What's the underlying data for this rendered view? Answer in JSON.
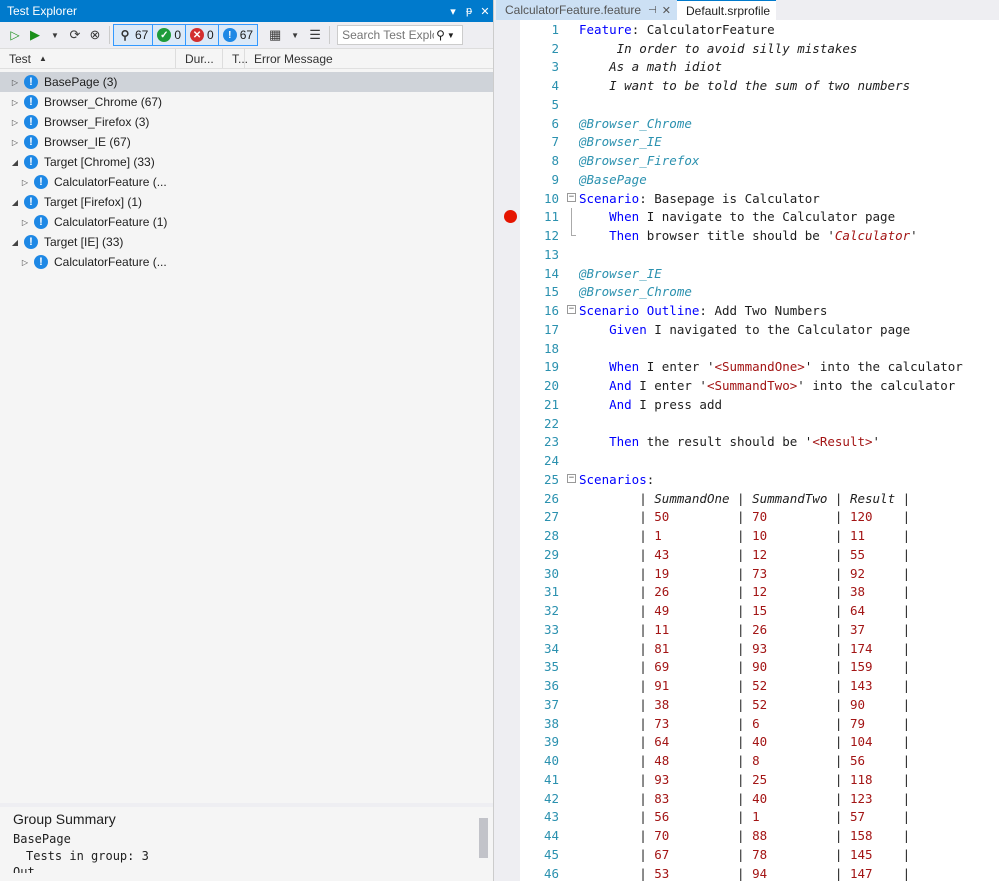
{
  "test_explorer": {
    "title": "Test Explorer",
    "title_controls": [
      "▾",
      "ᵽ",
      "✕"
    ],
    "toolbar": {
      "counts": [
        {
          "icon": "flask-icon",
          "value": "67"
        },
        {
          "icon": "passed-icon",
          "value": "0"
        },
        {
          "icon": "failed-icon",
          "value": "0"
        },
        {
          "icon": "not-run-icon",
          "value": "67"
        }
      ],
      "search_placeholder": "Search Test Explorer"
    },
    "columns": [
      "Test",
      "Dur...",
      "T...",
      "Error Message"
    ],
    "tree": [
      {
        "label": "BasePage  (3)",
        "expanded": false,
        "level": 0,
        "selected": true
      },
      {
        "label": "Browser_Chrome  (67)",
        "expanded": false,
        "level": 0
      },
      {
        "label": "Browser_Firefox  (3)",
        "expanded": false,
        "level": 0
      },
      {
        "label": "Browser_IE  (67)",
        "expanded": false,
        "level": 0
      },
      {
        "label": "Target [Chrome]  (33)",
        "expanded": true,
        "level": 0
      },
      {
        "label": "CalculatorFeature  (...",
        "expanded": false,
        "level": 1
      },
      {
        "label": "Target [Firefox]  (1)",
        "expanded": true,
        "level": 0
      },
      {
        "label": "CalculatorFeature  (1)",
        "expanded": false,
        "level": 1
      },
      {
        "label": "Target [IE]  (33)",
        "expanded": true,
        "level": 0
      },
      {
        "label": "CalculatorFeature  (...",
        "expanded": false,
        "level": 1
      }
    ],
    "summary": {
      "title": "Group Summary",
      "group_name": "BasePage",
      "tests_in_group": "Tests in group: 3",
      "next_line": "Out..."
    }
  },
  "editor": {
    "tabs": [
      {
        "label": "CalculatorFeature.feature",
        "active": false
      },
      {
        "label": "Default.srprofile",
        "active": true
      }
    ],
    "lines": [
      {
        "n": "1",
        "segs": [
          [
            "kw",
            "Feature"
          ],
          [
            "",
            ": CalculatorFeature"
          ]
        ]
      },
      {
        "n": "2",
        "segs": [
          [
            "desc",
            "     In order to avoid silly mistakes"
          ]
        ]
      },
      {
        "n": "3",
        "segs": [
          [
            "desc",
            "    As a math idiot"
          ]
        ]
      },
      {
        "n": "4",
        "segs": [
          [
            "desc",
            "    I want to be told the sum of two numbers"
          ]
        ]
      },
      {
        "n": "5",
        "segs": []
      },
      {
        "n": "6",
        "segs": [
          [
            "tag",
            "@Browser_Chrome"
          ]
        ]
      },
      {
        "n": "7",
        "segs": [
          [
            "tag",
            "@Browser_IE"
          ]
        ]
      },
      {
        "n": "8",
        "segs": [
          [
            "tag",
            "@Browser_Firefox"
          ]
        ]
      },
      {
        "n": "9",
        "segs": [
          [
            "tag",
            "@BasePage"
          ]
        ]
      },
      {
        "n": "10",
        "fold": "start",
        "segs": [
          [
            "kw",
            "Scenario"
          ],
          [
            "",
            ": Basepage is Calculator"
          ]
        ]
      },
      {
        "n": "11",
        "fold": "mid",
        "segs": [
          [
            "",
            "    "
          ],
          [
            "kw",
            "When"
          ],
          [
            "",
            " I navigate to the Calculator page"
          ]
        ]
      },
      {
        "n": "12",
        "fold": "end",
        "segs": [
          [
            "",
            "    "
          ],
          [
            "kw",
            "Then"
          ],
          [
            "",
            " browser title should be '"
          ],
          [
            "stri",
            "Calculator"
          ],
          [
            "",
            "'"
          ]
        ]
      },
      {
        "n": "13",
        "segs": []
      },
      {
        "n": "14",
        "segs": [
          [
            "tag",
            "@Browser_IE"
          ]
        ]
      },
      {
        "n": "15",
        "segs": [
          [
            "tag",
            "@Browser_Chrome"
          ]
        ]
      },
      {
        "n": "16",
        "fold": "start",
        "segs": [
          [
            "kw",
            "Scenario Outline"
          ],
          [
            "",
            ": Add Two Numbers"
          ]
        ]
      },
      {
        "n": "17",
        "segs": [
          [
            "",
            "    "
          ],
          [
            "kw",
            "Given"
          ],
          [
            "",
            " I navigated to the Calculator page"
          ]
        ]
      },
      {
        "n": "18",
        "segs": []
      },
      {
        "n": "19",
        "segs": [
          [
            "",
            "    "
          ],
          [
            "kw",
            "When"
          ],
          [
            "",
            " I enter '"
          ],
          [
            "pl",
            "<SummandOne>"
          ],
          [
            "",
            "' into the calculator"
          ]
        ]
      },
      {
        "n": "20",
        "segs": [
          [
            "",
            "    "
          ],
          [
            "kw",
            "And"
          ],
          [
            "",
            " I enter '"
          ],
          [
            "pl",
            "<SummandTwo>"
          ],
          [
            "",
            "' into the calculator"
          ]
        ]
      },
      {
        "n": "21",
        "segs": [
          [
            "",
            "    "
          ],
          [
            "kw",
            "And"
          ],
          [
            "",
            " I press add"
          ]
        ]
      },
      {
        "n": "22",
        "segs": []
      },
      {
        "n": "23",
        "segs": [
          [
            "",
            "    "
          ],
          [
            "kw",
            "Then"
          ],
          [
            "",
            " the result should be '"
          ],
          [
            "pl",
            "<Result>"
          ],
          [
            "",
            "'"
          ]
        ]
      },
      {
        "n": "24",
        "segs": []
      },
      {
        "n": "25",
        "fold": "start",
        "segs": [
          [
            "kw",
            "Scenarios"
          ],
          [
            "",
            ":"
          ]
        ]
      },
      {
        "n": "26",
        "segs": [
          [
            "",
            "        | "
          ],
          [
            "hdr",
            "SummandOne"
          ],
          [
            "",
            " | "
          ],
          [
            "hdr",
            "SummandTwo"
          ],
          [
            "",
            " | "
          ],
          [
            "hdr",
            "Result"
          ],
          [
            "",
            " |"
          ]
        ]
      },
      {
        "n": "27",
        "segs": [
          [
            "",
            "        | "
          ],
          [
            "str",
            "50        "
          ],
          [
            "",
            " | "
          ],
          [
            "str",
            "70        "
          ],
          [
            "",
            " | "
          ],
          [
            "str",
            "120   "
          ],
          [
            "",
            " |"
          ]
        ]
      },
      {
        "n": "28",
        "segs": [
          [
            "",
            "        | "
          ],
          [
            "str",
            "1         "
          ],
          [
            "",
            " | "
          ],
          [
            "str",
            "10        "
          ],
          [
            "",
            " | "
          ],
          [
            "str",
            "11    "
          ],
          [
            "",
            " |"
          ]
        ]
      },
      {
        "n": "29",
        "segs": [
          [
            "",
            "        | "
          ],
          [
            "str",
            "43        "
          ],
          [
            "",
            " | "
          ],
          [
            "str",
            "12        "
          ],
          [
            "",
            " | "
          ],
          [
            "str",
            "55    "
          ],
          [
            "",
            " |"
          ]
        ]
      },
      {
        "n": "30",
        "segs": [
          [
            "",
            "        | "
          ],
          [
            "str",
            "19        "
          ],
          [
            "",
            " | "
          ],
          [
            "str",
            "73        "
          ],
          [
            "",
            " | "
          ],
          [
            "str",
            "92    "
          ],
          [
            "",
            " |"
          ]
        ]
      },
      {
        "n": "31",
        "segs": [
          [
            "",
            "        | "
          ],
          [
            "str",
            "26        "
          ],
          [
            "",
            " | "
          ],
          [
            "str",
            "12        "
          ],
          [
            "",
            " | "
          ],
          [
            "str",
            "38    "
          ],
          [
            "",
            " |"
          ]
        ]
      },
      {
        "n": "32",
        "segs": [
          [
            "",
            "        | "
          ],
          [
            "str",
            "49        "
          ],
          [
            "",
            " | "
          ],
          [
            "str",
            "15        "
          ],
          [
            "",
            " | "
          ],
          [
            "str",
            "64    "
          ],
          [
            "",
            " |"
          ]
        ]
      },
      {
        "n": "33",
        "segs": [
          [
            "",
            "        | "
          ],
          [
            "str",
            "11        "
          ],
          [
            "",
            " | "
          ],
          [
            "str",
            "26        "
          ],
          [
            "",
            " | "
          ],
          [
            "str",
            "37    "
          ],
          [
            "",
            " |"
          ]
        ]
      },
      {
        "n": "34",
        "segs": [
          [
            "",
            "        | "
          ],
          [
            "str",
            "81        "
          ],
          [
            "",
            " | "
          ],
          [
            "str",
            "93        "
          ],
          [
            "",
            " | "
          ],
          [
            "str",
            "174   "
          ],
          [
            "",
            " |"
          ]
        ]
      },
      {
        "n": "35",
        "segs": [
          [
            "",
            "        | "
          ],
          [
            "str",
            "69        "
          ],
          [
            "",
            " | "
          ],
          [
            "str",
            "90        "
          ],
          [
            "",
            " | "
          ],
          [
            "str",
            "159   "
          ],
          [
            "",
            " |"
          ]
        ]
      },
      {
        "n": "36",
        "segs": [
          [
            "",
            "        | "
          ],
          [
            "str",
            "91        "
          ],
          [
            "",
            " | "
          ],
          [
            "str",
            "52        "
          ],
          [
            "",
            " | "
          ],
          [
            "str",
            "143   "
          ],
          [
            "",
            " |"
          ]
        ]
      },
      {
        "n": "37",
        "segs": [
          [
            "",
            "        | "
          ],
          [
            "str",
            "38        "
          ],
          [
            "",
            " | "
          ],
          [
            "str",
            "52        "
          ],
          [
            "",
            " | "
          ],
          [
            "str",
            "90    "
          ],
          [
            "",
            " |"
          ]
        ]
      },
      {
        "n": "38",
        "segs": [
          [
            "",
            "        | "
          ],
          [
            "str",
            "73        "
          ],
          [
            "",
            " | "
          ],
          [
            "str",
            "6         "
          ],
          [
            "",
            " | "
          ],
          [
            "str",
            "79    "
          ],
          [
            "",
            " |"
          ]
        ]
      },
      {
        "n": "39",
        "segs": [
          [
            "",
            "        | "
          ],
          [
            "str",
            "64        "
          ],
          [
            "",
            " | "
          ],
          [
            "str",
            "40        "
          ],
          [
            "",
            " | "
          ],
          [
            "str",
            "104   "
          ],
          [
            "",
            " |"
          ]
        ]
      },
      {
        "n": "40",
        "segs": [
          [
            "",
            "        | "
          ],
          [
            "str",
            "48        "
          ],
          [
            "",
            " | "
          ],
          [
            "str",
            "8         "
          ],
          [
            "",
            " | "
          ],
          [
            "str",
            "56    "
          ],
          [
            "",
            " |"
          ]
        ]
      },
      {
        "n": "41",
        "segs": [
          [
            "",
            "        | "
          ],
          [
            "str",
            "93        "
          ],
          [
            "",
            " | "
          ],
          [
            "str",
            "25        "
          ],
          [
            "",
            " | "
          ],
          [
            "str",
            "118   "
          ],
          [
            "",
            " |"
          ]
        ]
      },
      {
        "n": "42",
        "segs": [
          [
            "",
            "        | "
          ],
          [
            "str",
            "83        "
          ],
          [
            "",
            " | "
          ],
          [
            "str",
            "40        "
          ],
          [
            "",
            " | "
          ],
          [
            "str",
            "123   "
          ],
          [
            "",
            " |"
          ]
        ]
      },
      {
        "n": "43",
        "segs": [
          [
            "",
            "        | "
          ],
          [
            "str",
            "56        "
          ],
          [
            "",
            " | "
          ],
          [
            "str",
            "1         "
          ],
          [
            "",
            " | "
          ],
          [
            "str",
            "57    "
          ],
          [
            "",
            " |"
          ]
        ]
      },
      {
        "n": "44",
        "segs": [
          [
            "",
            "        | "
          ],
          [
            "str",
            "70        "
          ],
          [
            "",
            " | "
          ],
          [
            "str",
            "88        "
          ],
          [
            "",
            " | "
          ],
          [
            "str",
            "158   "
          ],
          [
            "",
            " |"
          ]
        ]
      },
      {
        "n": "45",
        "segs": [
          [
            "",
            "        | "
          ],
          [
            "str",
            "67        "
          ],
          [
            "",
            " | "
          ],
          [
            "str",
            "78        "
          ],
          [
            "",
            " | "
          ],
          [
            "str",
            "145   "
          ],
          [
            "",
            " |"
          ]
        ]
      },
      {
        "n": "46",
        "segs": [
          [
            "",
            "        | "
          ],
          [
            "str",
            "53        "
          ],
          [
            "",
            " | "
          ],
          [
            "str",
            "94        "
          ],
          [
            "",
            " | "
          ],
          [
            "str",
            "147   "
          ],
          [
            "",
            " |"
          ]
        ]
      }
    ]
  }
}
